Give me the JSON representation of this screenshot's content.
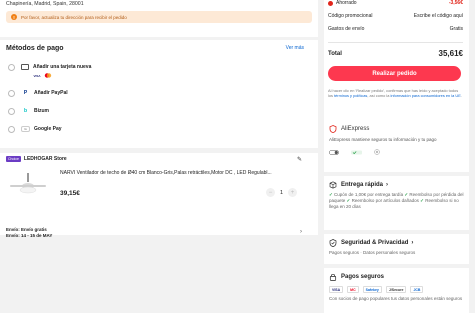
{
  "address": {
    "line": "Chapinería, Madrid, Spain, 28001",
    "warning": "Por favor, actualiza tu dirección para recibir el pedido"
  },
  "payment": {
    "title": "Métodos de pago",
    "more": "Ver más",
    "methods": [
      {
        "label": "Añadir una tarjeta nueva"
      },
      {
        "label": "Añadir PayPal"
      },
      {
        "label": "Bizum"
      },
      {
        "label": "Google Pay"
      }
    ],
    "card_brands": [
      "VISA",
      "MC"
    ]
  },
  "store": {
    "badge": "Choice",
    "name": "LEDHOGAR Store",
    "product_title": "NARVI Ventilador de techo de Ø40 cm Blanco-Gris,Palas retráctiles,Motor DC , LED Regulabl...",
    "price": "39,15€",
    "qty": "1",
    "minus": "−",
    "plus": "+",
    "ship_line1": "Envío: Envío gratis",
    "ship_line2": "Envío: 14 - 15 de MAY",
    "chevron": "›"
  },
  "summary": {
    "saved_label": "Ahorrado",
    "saved_value": "-3,56€",
    "promo_label": "Código promocional",
    "promo_value": "Escribe el código aquí",
    "shipping_label": "Gastos de envío",
    "shipping_value": "Gratis",
    "total_label": "Total",
    "total_value": "35,61€",
    "cta": "Realizar pedido",
    "legal_pre": "Al hacer clic en 'Realizar pedido', confirmas que has leído y aceptado todos los ",
    "legal_link1": "términos y políticas",
    "legal_mid": ", así como la ",
    "legal_link2": "información para consumidores en la UE",
    "legal_end": "."
  },
  "aliexpress": {
    "brand": "AliExpress",
    "text": "AliExpress mantiene seguros tu información y tu pago"
  },
  "delivery": {
    "title": "Entrega rápida",
    "lines": [
      "Cupón de 1,00€ por entrega tardía",
      "Reembolso por pérdida del paquete",
      "Reembolso por artículos dañados",
      "Reembolso si no llega en 20 días"
    ]
  },
  "privacy": {
    "title": "Seguridad & Privacidad",
    "text": "Pagos seguros · Datos personales seguros"
  },
  "secure_pay": {
    "title": "Pagos seguros",
    "logos": [
      "VISA",
      "MC",
      "Safekey",
      "J/Secure",
      "JCB"
    ],
    "text": "Con socios de pago populares tus datos personales están seguros"
  },
  "colors": {
    "accent": "#fd384f",
    "red": "#e1251b",
    "link": "#0a66d1",
    "warn_bg": "#fde9d6"
  }
}
